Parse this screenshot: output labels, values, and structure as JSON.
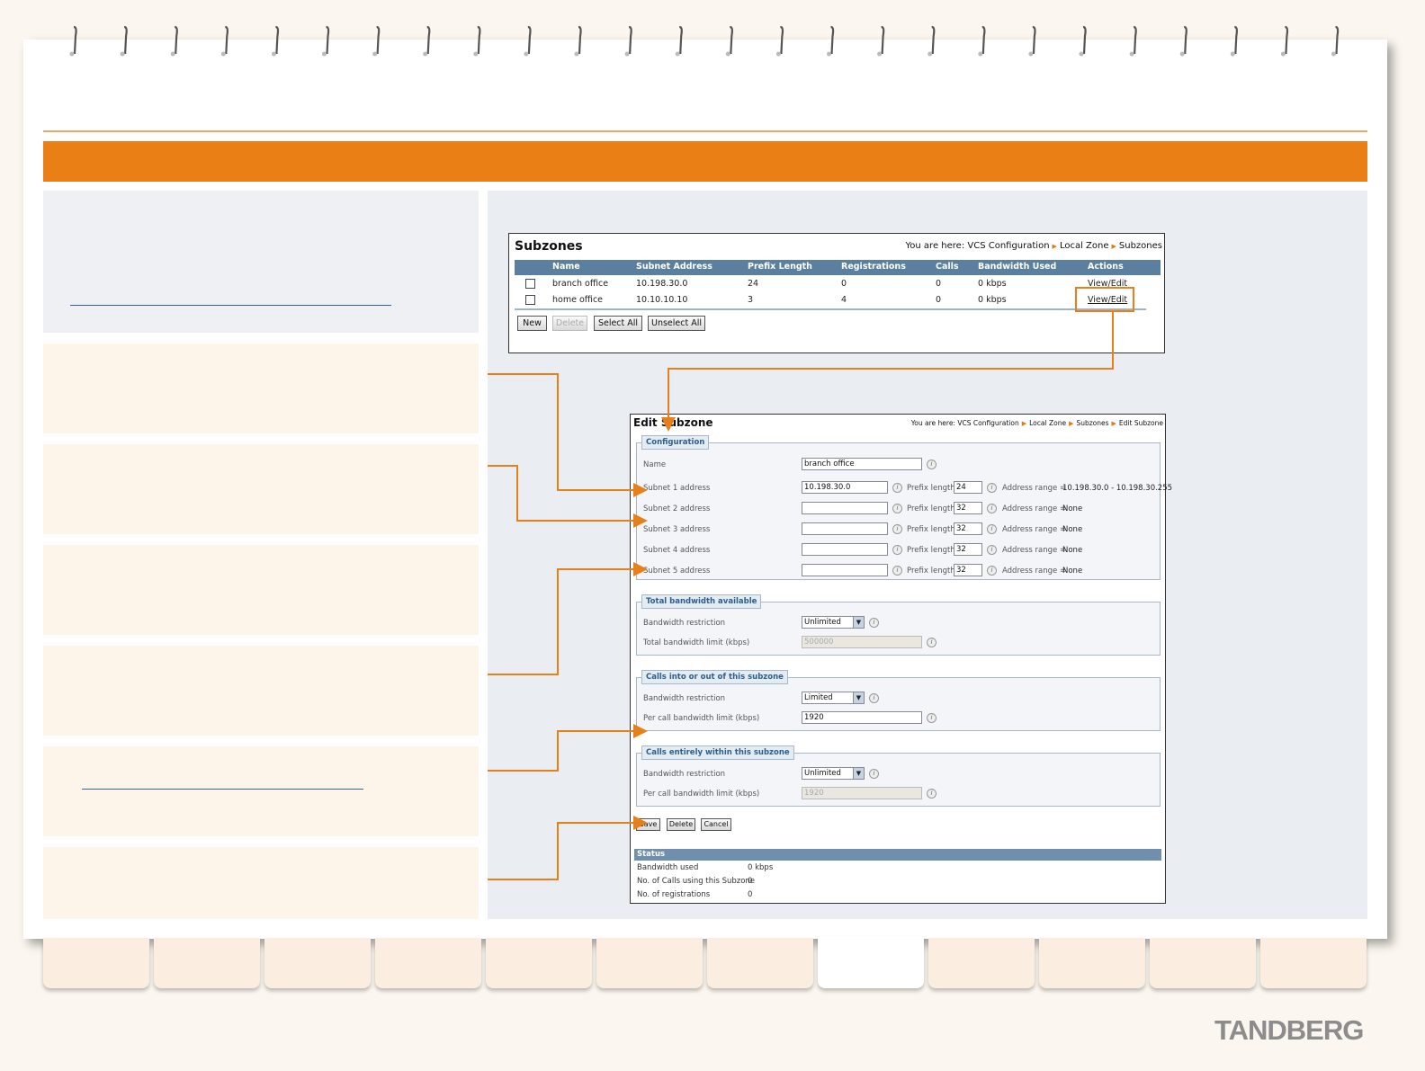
{
  "brand": "TANDBERG",
  "subzones_panel": {
    "title": "Subzones",
    "breadcrumb_prefix": "You are here:",
    "breadcrumbs": [
      "VCS Configuration",
      "Local Zone",
      "Subzones"
    ],
    "columns": [
      "Name",
      "Subnet Address",
      "Prefix Length",
      "Registrations",
      "Calls",
      "Bandwidth Used",
      "Actions"
    ],
    "rows": [
      {
        "name": "branch office",
        "subnet": "10.198.30.0",
        "prefix": "24",
        "registrations": "0",
        "calls": "0",
        "bandwidth": "0 kbps",
        "action": "View/Edit"
      },
      {
        "name": "home office",
        "subnet": "10.10.10.10",
        "prefix": "3",
        "registrations": "4",
        "calls": "0",
        "bandwidth": "0 kbps",
        "action": "View/Edit"
      }
    ],
    "buttons": {
      "new": "New",
      "delete": "Delete",
      "select_all": "Select All",
      "unselect_all": "Unselect All"
    }
  },
  "edit_panel": {
    "title": "Edit Subzone",
    "breadcrumb_prefix": "You are here:",
    "breadcrumbs": [
      "VCS Configuration",
      "Local Zone",
      "Subzones",
      "Edit Subzone"
    ],
    "configuration": {
      "legend": "Configuration",
      "name_label": "Name",
      "name_value": "branch office",
      "prefix_label": "Prefix length",
      "range_label": "Address range =",
      "subnets": [
        {
          "label": "Subnet 1 address",
          "address": "10.198.30.0",
          "prefix": "24",
          "range": "10.198.30.0 - 10.198.30.255"
        },
        {
          "label": "Subnet 2 address",
          "address": "",
          "prefix": "32",
          "range": "None"
        },
        {
          "label": "Subnet 3 address",
          "address": "",
          "prefix": "32",
          "range": "None"
        },
        {
          "label": "Subnet 4 address",
          "address": "",
          "prefix": "32",
          "range": "None"
        },
        {
          "label": "Subnet 5 address",
          "address": "",
          "prefix": "32",
          "range": "None"
        }
      ]
    },
    "total_bandwidth": {
      "legend": "Total bandwidth available",
      "restriction_label": "Bandwidth restriction",
      "restriction_value": "Unlimited",
      "limit_label": "Total bandwidth limit (kbps)",
      "limit_value": "500000"
    },
    "calls_in_out": {
      "legend": "Calls into or out of this subzone",
      "restriction_label": "Bandwidth restriction",
      "restriction_value": "Limited",
      "limit_label": "Per call bandwidth limit (kbps)",
      "limit_value": "1920"
    },
    "calls_within": {
      "legend": "Calls entirely within this subzone",
      "restriction_label": "Bandwidth restriction",
      "restriction_value": "Unlimited",
      "limit_label": "Per call bandwidth limit (kbps)",
      "limit_value": "1920"
    },
    "buttons": {
      "save": "Save",
      "delete": "Delete",
      "cancel": "Cancel"
    },
    "status": {
      "title": "Status",
      "rows": [
        {
          "label": "Bandwidth used",
          "value": "0 kbps"
        },
        {
          "label": "No. of Calls using this Subzone",
          "value": "0"
        },
        {
          "label": "No. of registrations",
          "value": "0"
        }
      ]
    }
  },
  "colors": {
    "accent_orange": "#ea7f16",
    "table_header": "#5a7f9f",
    "brand_gray": "#8c8c8c"
  }
}
